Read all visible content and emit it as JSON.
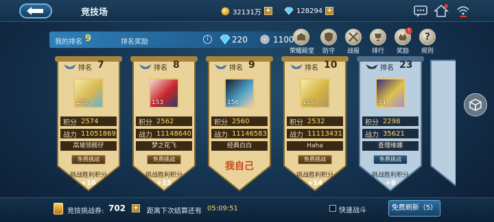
{
  "header": {
    "title": "竞技场",
    "gold": "32131万",
    "diamonds": "128294"
  },
  "rank_bar": {
    "my_rank_label": "我的排名",
    "my_rank": "9",
    "reward_label": "排名奖励",
    "reward_diamonds": "220",
    "reward_coins": "1100"
  },
  "menu": [
    {
      "label": "荣耀殿堂",
      "icon": "hall-of-honor-icon"
    },
    {
      "label": "防守",
      "icon": "defense-icon"
    },
    {
      "label": "战报",
      "icon": "battle-report-icon"
    },
    {
      "label": "排行",
      "icon": "leaderboard-icon"
    },
    {
      "label": "奖励",
      "icon": "reward-icon",
      "badge": "!"
    },
    {
      "label": "规则",
      "icon": "rules-icon"
    }
  ],
  "labels": {
    "rank": "排名",
    "score": "积分",
    "power": "战力",
    "free_challenge": "免费挑战",
    "win_reward": "挑战胜利积分",
    "myself": "我自己"
  },
  "opponents": [
    {
      "rank": "7",
      "level": "170",
      "score": "2574",
      "power": "11051869",
      "name": "高坡领舰仔",
      "reward": "+16",
      "self": false,
      "style": "gold"
    },
    {
      "rank": "8",
      "level": "153",
      "score": "2562",
      "power": "11148640",
      "name": "梦之花飞",
      "reward": "+15",
      "self": false,
      "style": "gold"
    },
    {
      "rank": "9",
      "level": "156",
      "score": "2560",
      "power": "11146583",
      "name": "经典白白",
      "reward": "",
      "self": true,
      "style": "gold"
    },
    {
      "rank": "10",
      "level": "155",
      "score": "2532",
      "power": "11113431",
      "name": "Haha",
      "reward": "+14",
      "self": false,
      "style": "gold"
    },
    {
      "rank": "23",
      "level": "34",
      "score": "2298",
      "power": "35621",
      "name": "查理维娜",
      "reward": "+8",
      "self": false,
      "style": "blue"
    }
  ],
  "bottom": {
    "ticket_label": "竞技挑战券:",
    "ticket_count": "702",
    "settlement_text": "距离下次结算还有",
    "countdown": "05:09:51",
    "fast_battle_label": "快速战斗",
    "refresh_label": "免费刷新（5）"
  },
  "colors": {
    "gold_banner": "#e9d39a",
    "blue_banner": "#b9cfe0",
    "accent_value": "#ffd966"
  }
}
